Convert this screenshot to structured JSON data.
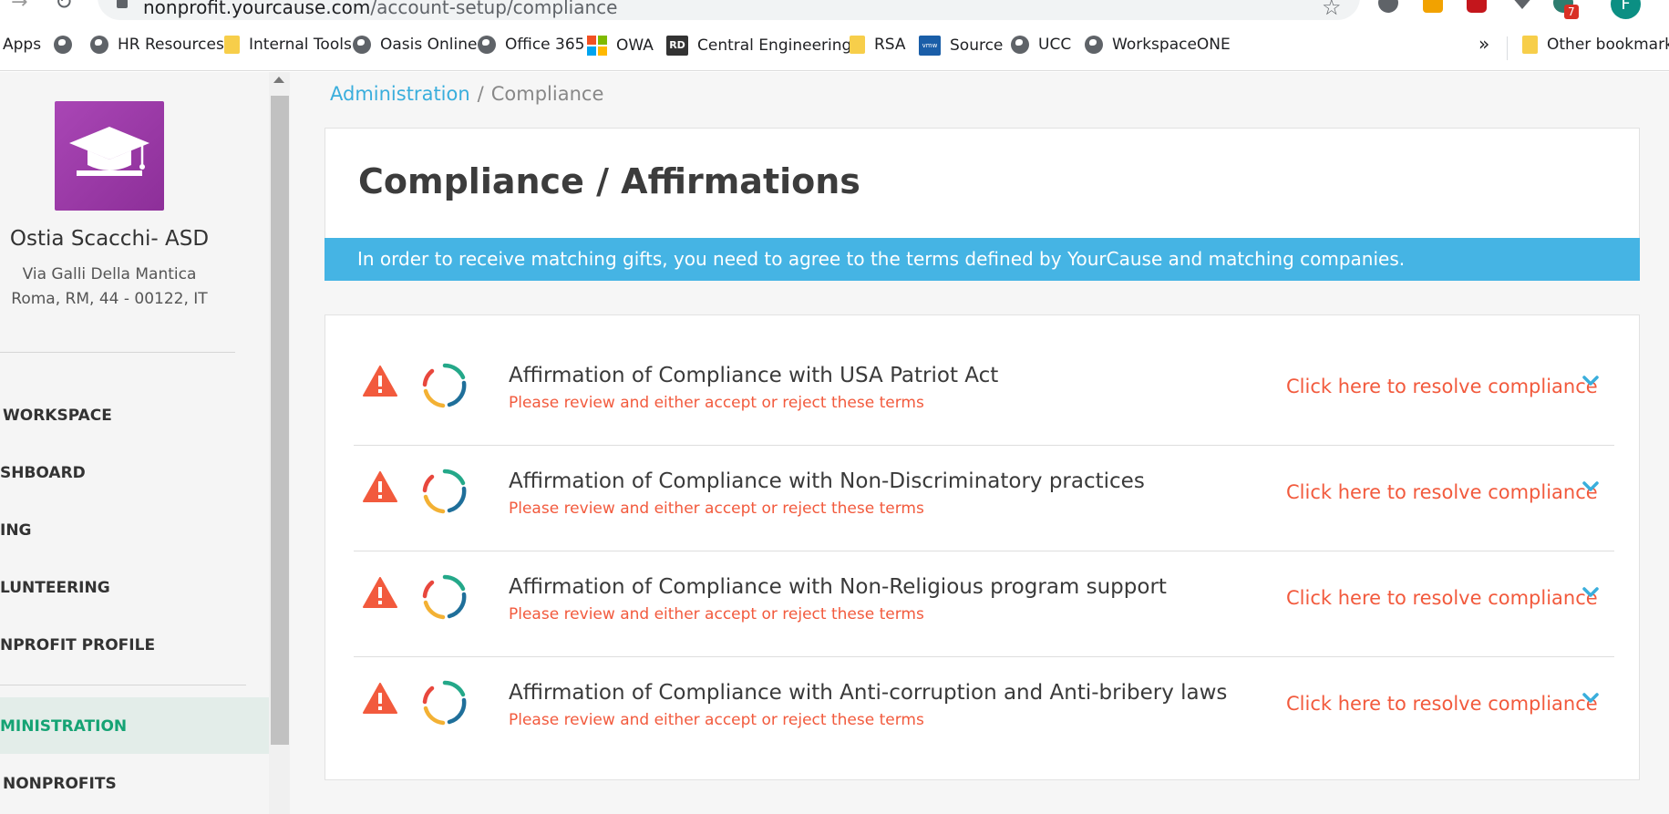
{
  "browser": {
    "url_host": "nonprofit.yourcause.com",
    "url_path": "/account-setup/compliance",
    "extension_badge": "7",
    "profile_initial": "F"
  },
  "bookmarks": {
    "items": [
      {
        "label": "Apps",
        "icon": "apps-grid-icon"
      },
      {
        "label": "",
        "icon": "globe-icon"
      },
      {
        "label": "HR Resources",
        "icon": "globe-icon"
      },
      {
        "label": "Internal Tools",
        "icon": "folder-icon"
      },
      {
        "label": "Oasis Online",
        "icon": "globe-icon"
      },
      {
        "label": "Office 365",
        "icon": "globe-icon"
      },
      {
        "label": "OWA",
        "icon": "microsoft-icon"
      },
      {
        "label": "Central Engineering...",
        "icon": "rd-icon"
      },
      {
        "label": "RSA",
        "icon": "folder-icon"
      },
      {
        "label": "Source",
        "icon": "vmw-icon"
      },
      {
        "label": "UCC",
        "icon": "globe-icon"
      },
      {
        "label": "WorkspaceONE",
        "icon": "globe-icon"
      }
    ],
    "more": "»",
    "other": "Other bookmarks"
  },
  "sidebar": {
    "org_name": "Ostia Scacchi- ASD",
    "address_line1": "Via Galli Della Mantica",
    "address_line2": "Roma, RM, 44 - 00122, IT",
    "nav": [
      {
        "label": "WORKSPACE",
        "active": false
      },
      {
        "label": "SHBOARD",
        "active": false
      },
      {
        "label": "ING",
        "active": false
      },
      {
        "label": "LUNTEERING",
        "active": false
      },
      {
        "label": "NPROFIT PROFILE",
        "active": false
      },
      {
        "label": "MINISTRATION",
        "active": true
      },
      {
        "label": "NONPROFITS",
        "active": false
      }
    ]
  },
  "breadcrumb": {
    "parent": "Administration",
    "separator": "/",
    "current": "Compliance"
  },
  "page": {
    "title": "Compliance / Affirmations",
    "banner": "In order to receive matching gifts, you need to agree to the terms defined by YourCause and matching companies."
  },
  "compliance_items": [
    {
      "title": "Affirmation of Compliance with USA Patriot Act",
      "subtitle": "Please review and either accept or reject these terms",
      "action": "Click here to resolve compliance"
    },
    {
      "title": "Affirmation of Compliance with Non-Discriminatory practices",
      "subtitle": "Please review and either accept or reject these terms",
      "action": "Click here to resolve compliance"
    },
    {
      "title": "Affirmation of Compliance with Non-Religious program support",
      "subtitle": "Please review and either accept or reject these terms",
      "action": "Click here to resolve compliance"
    },
    {
      "title": "Affirmation of Compliance with Anti-corruption and Anti-bribery laws",
      "subtitle": "Please review and either accept or reject these terms",
      "action": "Click here to resolve compliance"
    }
  ],
  "colors": {
    "accent_blue": "#45b4e4",
    "link_blue": "#3aaedc",
    "alert_orange": "#f25a3d",
    "active_green": "#15a374",
    "logo_purple": "#9b3aa7"
  }
}
